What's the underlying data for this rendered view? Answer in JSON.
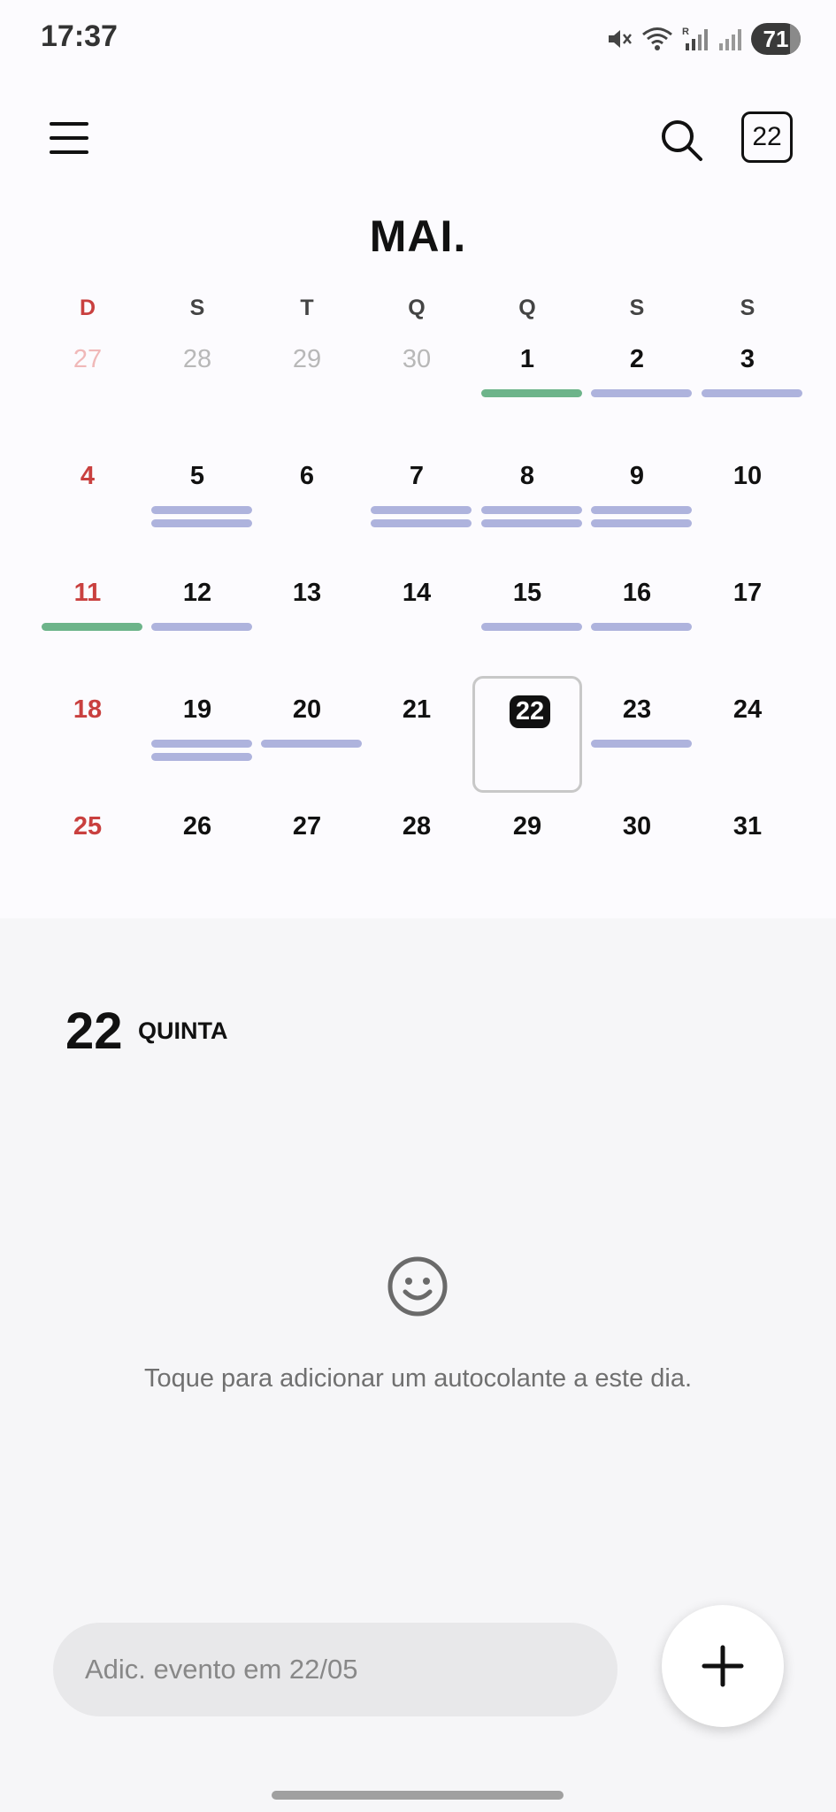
{
  "status_bar": {
    "time": "17:37",
    "battery": "71",
    "signal_label": "R"
  },
  "header": {
    "today_button_label": "22",
    "month_title": "MAI."
  },
  "weekdays": [
    "D",
    "S",
    "T",
    "Q",
    "Q",
    "S",
    "S"
  ],
  "weeks": [
    [
      {
        "d": "27",
        "other": true,
        "bars": []
      },
      {
        "d": "28",
        "other": true,
        "bars": []
      },
      {
        "d": "29",
        "other": true,
        "bars": []
      },
      {
        "d": "30",
        "other": true,
        "bars": []
      },
      {
        "d": "1",
        "bars": [
          "green"
        ]
      },
      {
        "d": "2",
        "bars": [
          "blue"
        ]
      },
      {
        "d": "3",
        "bars": [
          "blue"
        ]
      }
    ],
    [
      {
        "d": "4",
        "bars": []
      },
      {
        "d": "5",
        "bars": [
          "blue",
          "blue"
        ]
      },
      {
        "d": "6",
        "bars": []
      },
      {
        "d": "7",
        "bars": [
          "blue",
          "blue"
        ]
      },
      {
        "d": "8",
        "bars": [
          "blue",
          "blue"
        ]
      },
      {
        "d": "9",
        "bars": [
          "blue",
          "blue"
        ]
      },
      {
        "d": "10",
        "bars": []
      }
    ],
    [
      {
        "d": "11",
        "bars": [
          "green"
        ]
      },
      {
        "d": "12",
        "bars": [
          "blue"
        ]
      },
      {
        "d": "13",
        "bars": []
      },
      {
        "d": "14",
        "bars": []
      },
      {
        "d": "15",
        "bars": [
          "blue"
        ]
      },
      {
        "d": "16",
        "bars": [
          "blue"
        ]
      },
      {
        "d": "17",
        "bars": []
      }
    ],
    [
      {
        "d": "18",
        "bars": []
      },
      {
        "d": "19",
        "bars": [
          "blue",
          "blue"
        ]
      },
      {
        "d": "20",
        "bars": [
          "blue"
        ]
      },
      {
        "d": "21",
        "bars": []
      },
      {
        "d": "22",
        "selected": true,
        "bars": []
      },
      {
        "d": "23",
        "bars": [
          "blue"
        ]
      },
      {
        "d": "24",
        "bars": []
      }
    ],
    [
      {
        "d": "25",
        "bars": []
      },
      {
        "d": "26",
        "bars": []
      },
      {
        "d": "27",
        "bars": []
      },
      {
        "d": "28",
        "bars": []
      },
      {
        "d": "29",
        "bars": []
      },
      {
        "d": "30",
        "bars": []
      },
      {
        "d": "31",
        "bars": []
      }
    ]
  ],
  "colors": {
    "sunday": "#c9403f",
    "event_green": "#6db48a",
    "event_blue": "#aeb3dd"
  },
  "day_detail": {
    "day_number": "22",
    "day_name": "QUINTA",
    "sticker_hint": "Toque para adicionar um autocolante a este dia."
  },
  "add_event": {
    "placeholder": "Adic. evento em 22/05"
  },
  "icons": {
    "menu": "menu-icon",
    "search": "search-icon",
    "smiley": "smiley-icon",
    "add": "plus-icon",
    "mute": "mute-icon",
    "wifi": "wifi-icon",
    "signal": "signal-icon"
  }
}
